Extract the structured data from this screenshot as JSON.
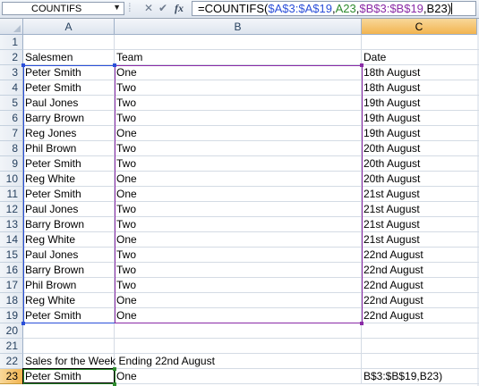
{
  "formula_bar": {
    "name_box": "COUNTIFS",
    "name_box_arrow": "▼",
    "icon_sep": "⁞",
    "icon_cancel": "✕",
    "icon_enter": "✔",
    "icon_fx": "fx",
    "formula_parts": {
      "p1": "=COUNTIFS(",
      "p2": "$A$3:$A$19",
      "p3": ",",
      "p4": "A23",
      "p5": ",",
      "p6": "$B$3:$B$19",
      "p7": ",",
      "p8": "B23",
      "p9": ")"
    }
  },
  "columns": [
    {
      "label": "",
      "key": "corner"
    },
    {
      "label": "A"
    },
    {
      "label": "B"
    },
    {
      "label": "C"
    }
  ],
  "rows": [
    {
      "num": "1",
      "a": "",
      "b": "",
      "c": ""
    },
    {
      "num": "2",
      "a": "Salesmen",
      "b": "Team",
      "c": "Date"
    },
    {
      "num": "3",
      "a": "Peter Smith",
      "b": "One",
      "c": "18th August"
    },
    {
      "num": "4",
      "a": "Peter Smith",
      "b": "Two",
      "c": "18th August"
    },
    {
      "num": "5",
      "a": "Paul Jones",
      "b": "Two",
      "c": "19th August"
    },
    {
      "num": "6",
      "a": "Barry Brown",
      "b": "Two",
      "c": "19th August"
    },
    {
      "num": "7",
      "a": "Reg Jones",
      "b": "One",
      "c": "19th August"
    },
    {
      "num": "8",
      "a": "Phil Brown",
      "b": "Two",
      "c": "20th August"
    },
    {
      "num": "9",
      "a": "Peter Smith",
      "b": "Two",
      "c": "20th August"
    },
    {
      "num": "10",
      "a": "Reg White",
      "b": "One",
      "c": "20th August"
    },
    {
      "num": "11",
      "a": "Peter Smith",
      "b": "One",
      "c": "21st August"
    },
    {
      "num": "12",
      "a": "Paul Jones",
      "b": "Two",
      "c": "21st August"
    },
    {
      "num": "13",
      "a": "Barry Brown",
      "b": "Two",
      "c": "21st August"
    },
    {
      "num": "14",
      "a": "Reg White",
      "b": "One",
      "c": "21st August"
    },
    {
      "num": "15",
      "a": "Paul Jones",
      "b": "Two",
      "c": "22nd August"
    },
    {
      "num": "16",
      "a": "Barry Brown",
      "b": "Two",
      "c": "22nd August"
    },
    {
      "num": "17",
      "a": "Phil Brown",
      "b": "Two",
      "c": "22nd August"
    },
    {
      "num": "18",
      "a": "Reg White",
      "b": "One",
      "c": "22nd August"
    },
    {
      "num": "19",
      "a": "Peter Smith",
      "b": "One",
      "c": "22nd August"
    },
    {
      "num": "20",
      "a": "",
      "b": "",
      "c": ""
    },
    {
      "num": "21",
      "a": "",
      "b": "",
      "c": ""
    },
    {
      "num": "22",
      "a": "Sales for the Week Ending 22nd August",
      "b": "",
      "c": ""
    },
    {
      "num": "23",
      "a": "Peter Smith",
      "b": "One",
      "c": "B$3:$B$19,B23)"
    }
  ],
  "colors": {
    "range_a": "#2b4fd9",
    "range_b": "#8a2aa6",
    "range_cell": "#2e8b2e",
    "selected_header": "#f2b450"
  }
}
